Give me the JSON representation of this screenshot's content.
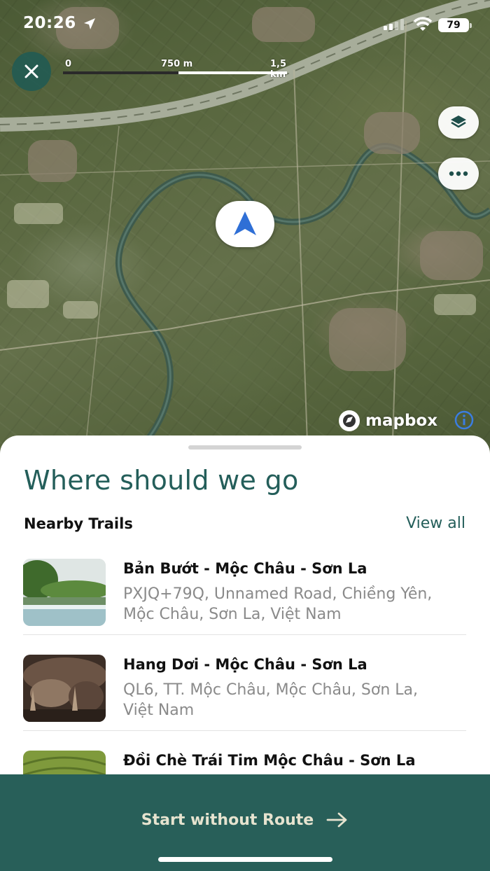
{
  "status_bar": {
    "time": "20:26",
    "battery": "79"
  },
  "map": {
    "scale": {
      "start": "0",
      "mid": "750 m",
      "end": "1,5 km"
    },
    "attribution": "mapbox",
    "controls": [
      "layers-icon",
      "more-icon"
    ],
    "marker": "navigation-arrow-icon"
  },
  "sheet": {
    "title": "Where should we go",
    "section_label": "Nearby Trails",
    "view_all": "View all",
    "trails": [
      {
        "name": "Bản Bướt - Mộc Châu - Sơn La",
        "address": "PXJQ+79Q, Unnamed Road, Chiềng Yên, Mộc Châu, Sơn La, Việt Nam"
      },
      {
        "name": "Hang Dơi - Mộc Châu - Sơn La",
        "address": "QL6, TT. Mộc Châu, Mộc Châu, Sơn La, Việt Nam"
      },
      {
        "name": "Đồi Chè Trái Tim Mộc Châu - Sơn La",
        "address": ""
      }
    ]
  },
  "bottom": {
    "start_label": "Start without Route"
  },
  "colors": {
    "accent": "#245e5a",
    "bottom_bar": "#285f59",
    "start_text": "#e6e3cf",
    "marker": "#2f6fd6"
  }
}
